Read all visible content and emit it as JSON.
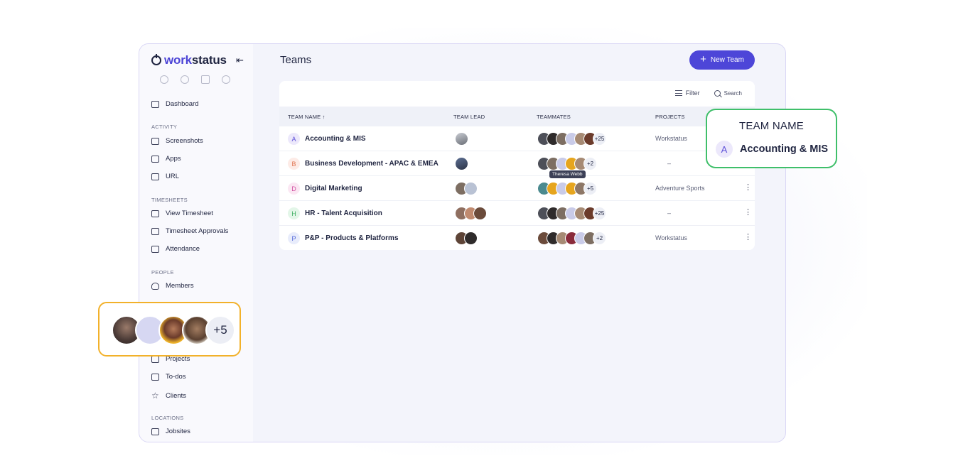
{
  "brand": {
    "name_accent": "work",
    "name_rest": "status"
  },
  "sidebar": {
    "dashboard": "Dashboard",
    "sections": [
      {
        "title": "ACTIVITY",
        "items": [
          "Screenshots",
          "Apps",
          "URL"
        ]
      },
      {
        "title": "TIMESHEETS",
        "items": [
          "View Timesheet",
          "Timesheet Approvals",
          "Attendance"
        ]
      },
      {
        "title": "PEOPLE",
        "items": [
          "Members"
        ]
      },
      {
        "title": "",
        "items": [
          "Projects",
          "To-dos",
          "Clients"
        ]
      },
      {
        "title": "LOCATIONS",
        "items": [
          "Jobsites"
        ]
      }
    ]
  },
  "header": {
    "title": "Teams",
    "new_team": "New Team"
  },
  "toolbar": {
    "filter": "Filter",
    "search": "Search"
  },
  "table": {
    "columns": {
      "team_name": "TEAM NAME ↑",
      "team_lead": "TEAM LEAD",
      "teammates": "TEAMMATES",
      "projects": "PROJECTS"
    },
    "rows": [
      {
        "initial": "A",
        "name": "Accounting & MIS",
        "more": "+25",
        "project": "Workstatus",
        "init_bg": "#ece8fb",
        "init_fg": "#5d50d8"
      },
      {
        "initial": "B",
        "name": "Business Development - APAC & EMEA",
        "more": "+2",
        "project": "–",
        "init_bg": "#fdebe6",
        "init_fg": "#e0734f"
      },
      {
        "initial": "D",
        "name": "Digital Marketing",
        "more": "+5",
        "project": "Adventure Sports",
        "init_bg": "#fbe7f3",
        "init_fg": "#d14ea0"
      },
      {
        "initial": "H",
        "name": "HR - Talent Acquisition",
        "more": "+25",
        "project": "–",
        "init_bg": "#e3f6e8",
        "init_fg": "#3fae62"
      },
      {
        "initial": "P",
        "name": "P&P - Products & Platforms",
        "more": "+2",
        "project": "Workstatus",
        "init_bg": "#e8ecfb",
        "init_fg": "#4d63d8"
      }
    ]
  },
  "tooltip": "Theresa Webb",
  "callout_team": {
    "header": "TEAM NAME",
    "initial": "A",
    "name": "Accounting & MIS"
  },
  "callout_avatars": {
    "more": "+5"
  },
  "colors": {
    "accent": "#4d46d8",
    "callout_green": "#3fbf6a",
    "callout_orange": "#f2b12a"
  }
}
